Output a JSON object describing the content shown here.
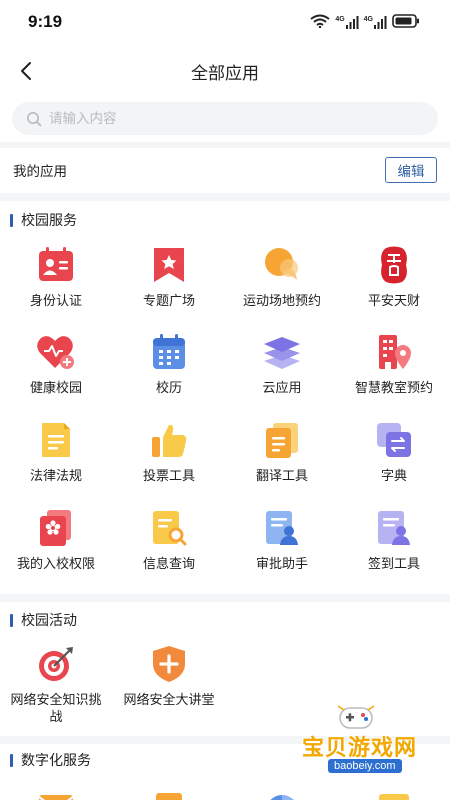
{
  "status_bar": {
    "time": "9:19",
    "signal_1": "4G",
    "signal_2": "4G"
  },
  "nav": {
    "title": "全部应用"
  },
  "search": {
    "placeholder": "请输入内容",
    "value": ""
  },
  "my_apps": {
    "title": "我的应用",
    "edit_label": "编辑"
  },
  "sections": [
    {
      "title": "校园服务",
      "apps": [
        {
          "label": "身份认证",
          "icon": "id-card-icon"
        },
        {
          "label": "专题广场",
          "icon": "bookmark-star-icon"
        },
        {
          "label": "运动场地预约",
          "icon": "chat-bubble-icon"
        },
        {
          "label": "平安天财",
          "icon": "seal-icon"
        },
        {
          "label": "健康校园",
          "icon": "heart-plus-icon"
        },
        {
          "label": "校历",
          "icon": "calendar-icon"
        },
        {
          "label": "云应用",
          "icon": "layers-icon"
        },
        {
          "label": "智慧教室预约",
          "icon": "building-pin-icon"
        },
        {
          "label": "法律法规",
          "icon": "document-icon"
        },
        {
          "label": "投票工具",
          "icon": "thumbs-up-icon"
        },
        {
          "label": "翻译工具",
          "icon": "translate-doc-icon"
        },
        {
          "label": "字典",
          "icon": "dictionary-icon"
        },
        {
          "label": "我的入校权限",
          "icon": "badge-flower-icon"
        },
        {
          "label": "信息查询",
          "icon": "search-doc-icon"
        },
        {
          "label": "审批助手",
          "icon": "approval-icon"
        },
        {
          "label": "签到工具",
          "icon": "sign-in-icon"
        }
      ]
    },
    {
      "title": "校园活动",
      "apps": [
        {
          "label": "网络安全知识挑战",
          "icon": "target-icon"
        },
        {
          "label": "网络安全大讲堂",
          "icon": "shield-plus-icon"
        }
      ]
    },
    {
      "title": "数字化服务",
      "apps": [
        {
          "label": "",
          "icon": "mail-icon"
        },
        {
          "label": "",
          "icon": "document-icon"
        },
        {
          "label": "",
          "icon": "pie-icon"
        },
        {
          "label": "",
          "icon": "folder-icon"
        }
      ]
    }
  ],
  "watermark": {
    "text": "宝贝游戏网",
    "url": "baobeiy.com"
  },
  "colors": {
    "accent": "#2d5fb3",
    "red": "#e8454f",
    "orange": "#f6a534",
    "blue": "#5b8fe6",
    "purple": "#7c74e4"
  }
}
